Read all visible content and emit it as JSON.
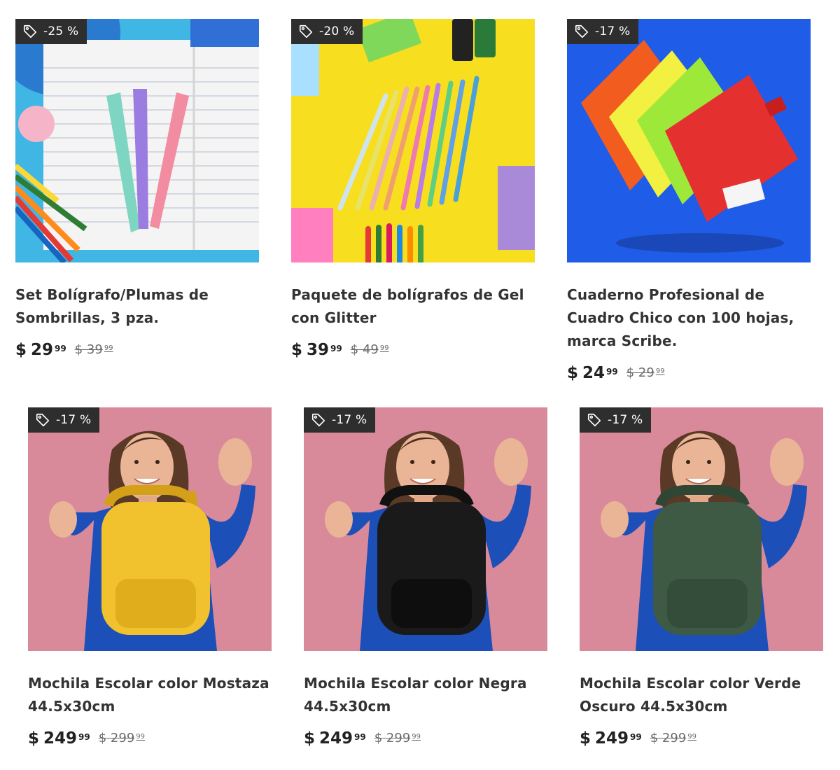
{
  "currency": "$",
  "products": [
    {
      "badge": "-25 %",
      "title": "Set Bolígrafo/Plumas de Sombrillas, 3 pza.",
      "price_int": "29",
      "price_dec": "99",
      "old_int": "39",
      "old_dec": "99",
      "image": "umbrella-pens"
    },
    {
      "badge": "-20 %",
      "title": "Paquete de bolígrafos de Gel con Glitter",
      "price_int": "39",
      "price_dec": "99",
      "old_int": "49",
      "old_dec": "99",
      "image": "gel-pens"
    },
    {
      "badge": "-17 %",
      "title": "Cuaderno Profesional de Cuadro Chico con 100 hojas, marca Scribe.",
      "price_int": "24",
      "price_dec": "99",
      "old_int": "29",
      "old_dec": "99",
      "image": "notebooks"
    },
    {
      "badge": "-17 %",
      "title": "Mochila Escolar color Mostaza 44.5x30cm",
      "price_int": "249",
      "price_dec": "99",
      "old_int": "299",
      "old_dec": "99",
      "image": "backpack-yellow",
      "bag_color": "#f2c12e"
    },
    {
      "badge": "-17 %",
      "title": "Mochila Escolar color Negra 44.5x30cm",
      "price_int": "249",
      "price_dec": "99",
      "old_int": "299",
      "old_dec": "99",
      "image": "backpack-black",
      "bag_color": "#1a1a1a"
    },
    {
      "badge": "-17 %",
      "title": "Mochila Escolar color Verde Oscuro 44.5x30cm",
      "price_int": "249",
      "price_dec": "99",
      "old_int": "299",
      "old_dec": "99",
      "image": "backpack-green",
      "bag_color": "#3e5a45"
    }
  ],
  "colors": {
    "badge_bg": "#2e2e2e",
    "pink_bg": "#d98a9a",
    "yellow_bg": "#f7de1e",
    "blue_bg": "#1f5ce8",
    "sky_bg": "#3fb6e3"
  }
}
